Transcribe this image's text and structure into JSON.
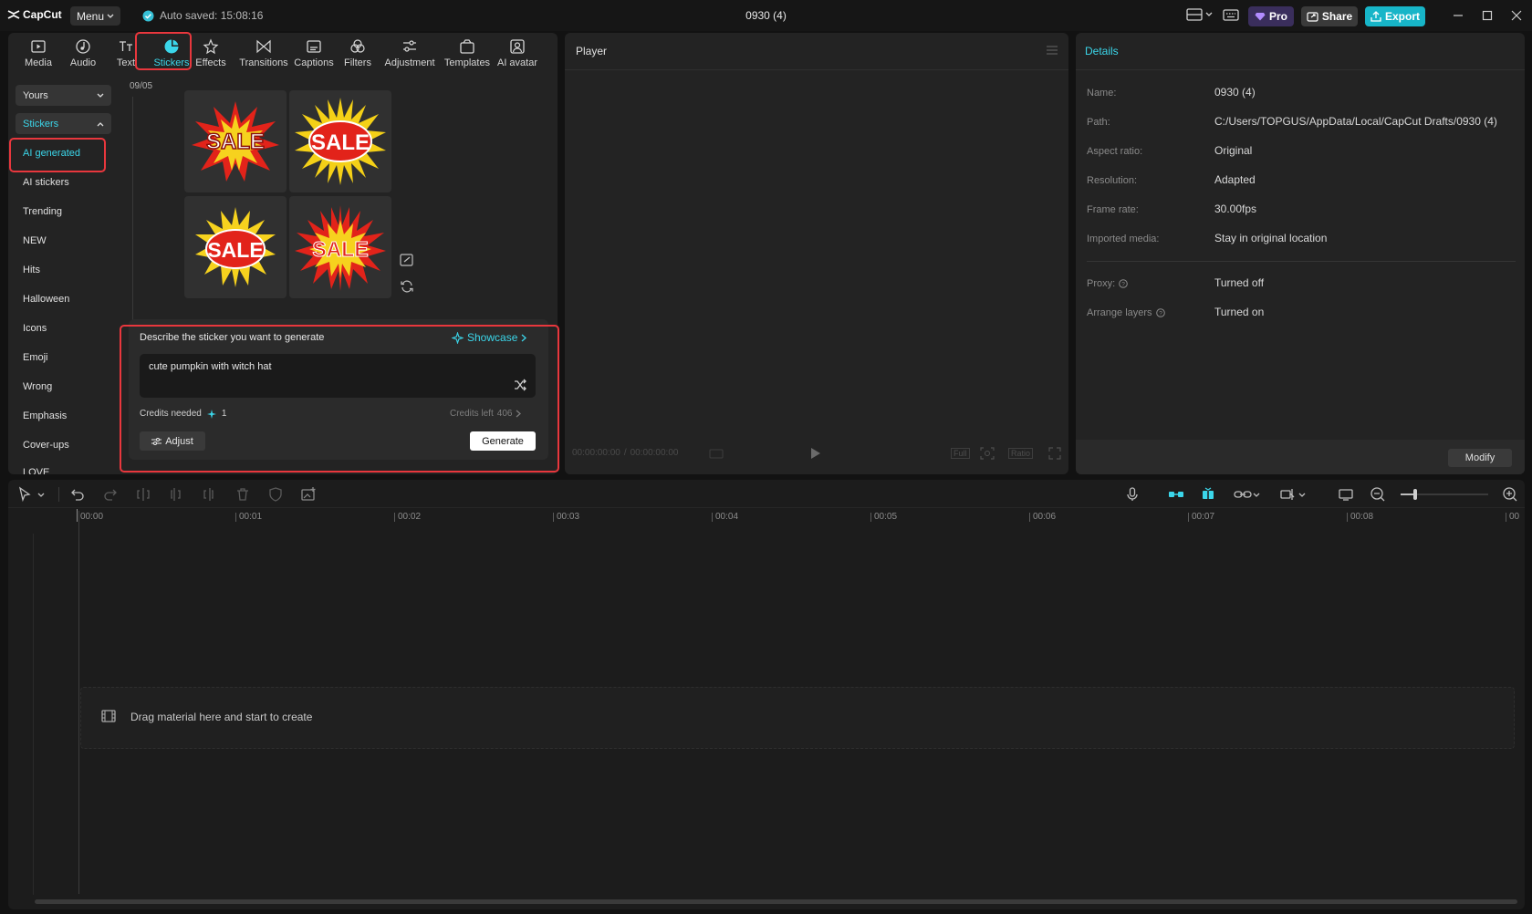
{
  "app": {
    "logo_text": "CapCut",
    "menu_label": "Menu",
    "autosave_text": "Auto saved: 15:08:16",
    "title": "0930 (4)",
    "pro_label": "Pro",
    "share_label": "Share",
    "export_label": "Export"
  },
  "toolbar": {
    "tabs": [
      "Media",
      "Audio",
      "Text",
      "Stickers",
      "Effects",
      "Transitions",
      "Captions",
      "Filters",
      "Adjustment",
      "Templates",
      "AI avatar"
    ],
    "active": "Stickers"
  },
  "categories": {
    "yours_label": "Yours",
    "stickers_label": "Stickers",
    "items": [
      "AI generated",
      "AI stickers",
      "Trending",
      "NEW",
      "Hits",
      "Halloween",
      "Icons",
      "Emoji",
      "Wrong",
      "Emphasis",
      "Cover-ups",
      "LOVE"
    ],
    "selected": "AI generated"
  },
  "gallery": {
    "date": "09/05",
    "stickers": [
      {
        "text": "SALE",
        "style": "red starburst",
        "note": "SALE"
      },
      {
        "text": "SALE",
        "style": "yellow burst red oval"
      },
      {
        "text": "SALE",
        "style": "yellow burst red oval"
      },
      {
        "text": "SALE",
        "style": "red yellow starburst"
      }
    ]
  },
  "ai_generator": {
    "heading": "Describe the sticker you want to generate",
    "showcase_label": "Showcase",
    "prompt_value": "cute pumpkin with witch hat",
    "credits_needed_label": "Credits needed",
    "credits_needed_value": "1",
    "credits_left_label": "Credits left",
    "credits_left_value": "406",
    "adjust_label": "Adjust",
    "generate_label": "Generate"
  },
  "player": {
    "title": "Player",
    "time_current": "00:00:00:00",
    "time_total": "00:00:00:00",
    "full_label": "Full",
    "ratio_label": "Ratio"
  },
  "details": {
    "title": "Details",
    "rows": [
      {
        "label": "Name:",
        "value": "0930 (4)"
      },
      {
        "label": "Path:",
        "value": "C:/Users/TOPGUS/AppData/Local/CapCut Drafts/0930 (4)"
      },
      {
        "label": "Aspect ratio:",
        "value": "Original"
      },
      {
        "label": "Resolution:",
        "value": "Adapted"
      },
      {
        "label": "Frame rate:",
        "value": "30.00fps"
      },
      {
        "label": "Imported media:",
        "value": "Stay in original location"
      },
      {
        "label": "Proxy:",
        "value": "Turned off"
      },
      {
        "label": "Arrange layers",
        "value": "Turned on"
      }
    ],
    "modify_label": "Modify"
  },
  "timeline": {
    "ticks": [
      "00:00",
      "00:01",
      "00:02",
      "00:03",
      "00:04",
      "00:05",
      "00:06",
      "00:07",
      "00:08",
      "00"
    ],
    "empty_hint": "Drag material here and start to create"
  },
  "colors": {
    "accent": "#3bd6ea",
    "highlight_border": "#e8373d",
    "export_bg": "#17b5c8",
    "pro_bg": "#3a2e5c"
  }
}
